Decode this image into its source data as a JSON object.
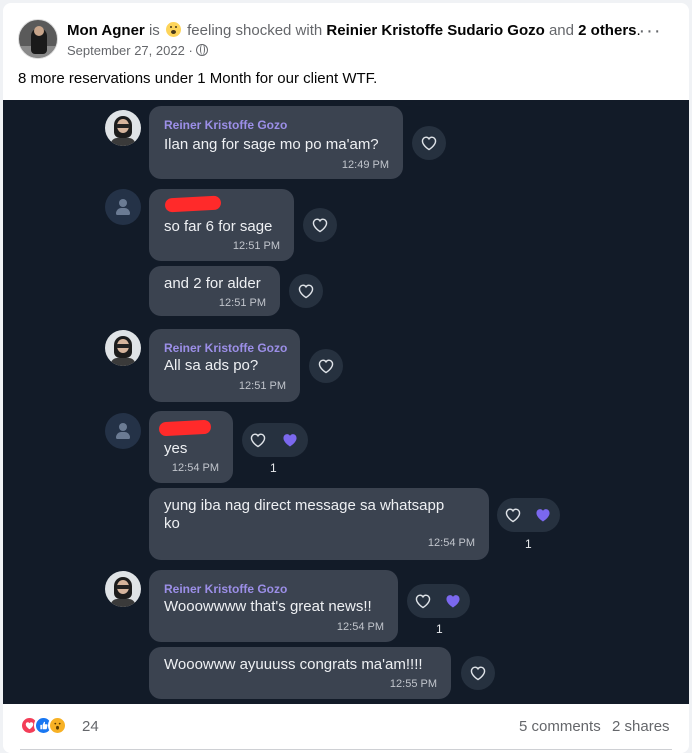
{
  "post": {
    "author": "Mon Agner",
    "is_text": "is",
    "feeling_text": "feeling shocked with",
    "tagged": "Reinier Kristoffe Sudario Gozo",
    "and_text": "and",
    "others": "2 others",
    "period": ".",
    "date": "September 27, 2022",
    "dot": "·",
    "body": "8 more reservations under 1 Month for our client WTF.",
    "more_label": "···",
    "icons": {
      "audience": "globe-icon",
      "feeling": "shocked-emoji-icon",
      "menu": "more-options-icon"
    }
  },
  "chat": {
    "accent": "#9c8fe8",
    "background": "#121b28",
    "bubble_color": "#3b4350",
    "messages": [
      {
        "sender": "Reiner Kristoffe Gozo",
        "text": "Ilan ang for sage mo po ma'am?",
        "time": "12:49 PM"
      },
      {
        "sender": "",
        "text": "so far 6 for sage",
        "time": "12:51 PM"
      },
      {
        "sender": "",
        "text": "and 2 for alder",
        "time": "12:51 PM"
      },
      {
        "sender": "Reiner Kristoffe Gozo",
        "text": "All sa ads po?",
        "time": "12:51 PM"
      },
      {
        "sender": "",
        "text": "yes",
        "time": "12:54 PM",
        "reaction_count": "1"
      },
      {
        "sender": "",
        "text_line1": "yung iba nag direct message sa whatsapp",
        "text_line2": "ko",
        "time": "12:54 PM",
        "reaction_count": "1"
      },
      {
        "sender": "Reiner Kristoffe Gozo",
        "text": "Wooowwww that's great news!!",
        "time": "12:54 PM",
        "reaction_count": "1"
      },
      {
        "sender": "",
        "text": "Wooowww ayuuuss congrats ma'am!!!!",
        "time": "12:55 PM"
      }
    ]
  },
  "footer": {
    "reaction_total": "24",
    "reaction_types": [
      "love",
      "like",
      "wow"
    ],
    "comments": "5 comments",
    "shares": "2 shares"
  }
}
